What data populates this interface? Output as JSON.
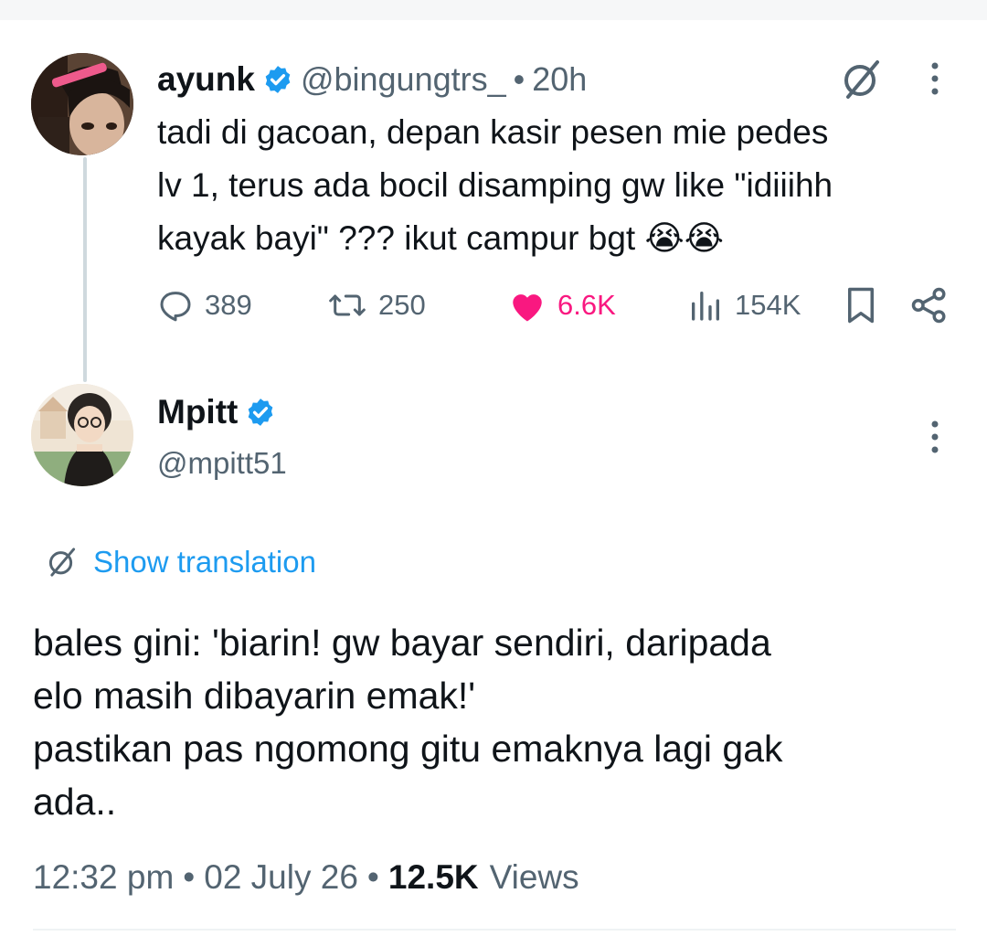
{
  "parent_tweet": {
    "author_name": "ayunk",
    "handle": "@bingungtrs_",
    "separator": "•",
    "time": "20h",
    "text_lines": [
      "tadi di gacoan, depan kasir pesen mie pedes",
      "lv 1, terus ada bocil disamping gw like \"idiiihh",
      "kayak bayi\" ??? ikut campur bgt 😭😭"
    ],
    "stats": {
      "replies": "389",
      "reposts": "250",
      "likes": "6.6K",
      "views": "154K"
    },
    "icons": [
      "grok-icon",
      "more-icon",
      "reply-icon",
      "repost-icon",
      "heart-icon",
      "views-icon",
      "bookmark-icon",
      "share-icon"
    ]
  },
  "reply_tweet": {
    "author_name": "Mpitt",
    "handle": "@mpitt51",
    "show_translation": "Show translation",
    "text_lines": [
      "bales gini: 'biarin! gw bayar sendiri, daripada",
      "elo masih dibayarin emak!'",
      "pastikan pas ngomong gitu emaknya lagi gak",
      "ada.."
    ],
    "time": "12:32 pm",
    "date": "02 July 26",
    "separator": "•",
    "views_count": "12.5K",
    "views_label": "Views"
  },
  "colors": {
    "accent_blue": "#1d9bf0",
    "like_pink": "#f91880",
    "secondary_text": "#536471",
    "thread_line": "#cfd9de"
  }
}
